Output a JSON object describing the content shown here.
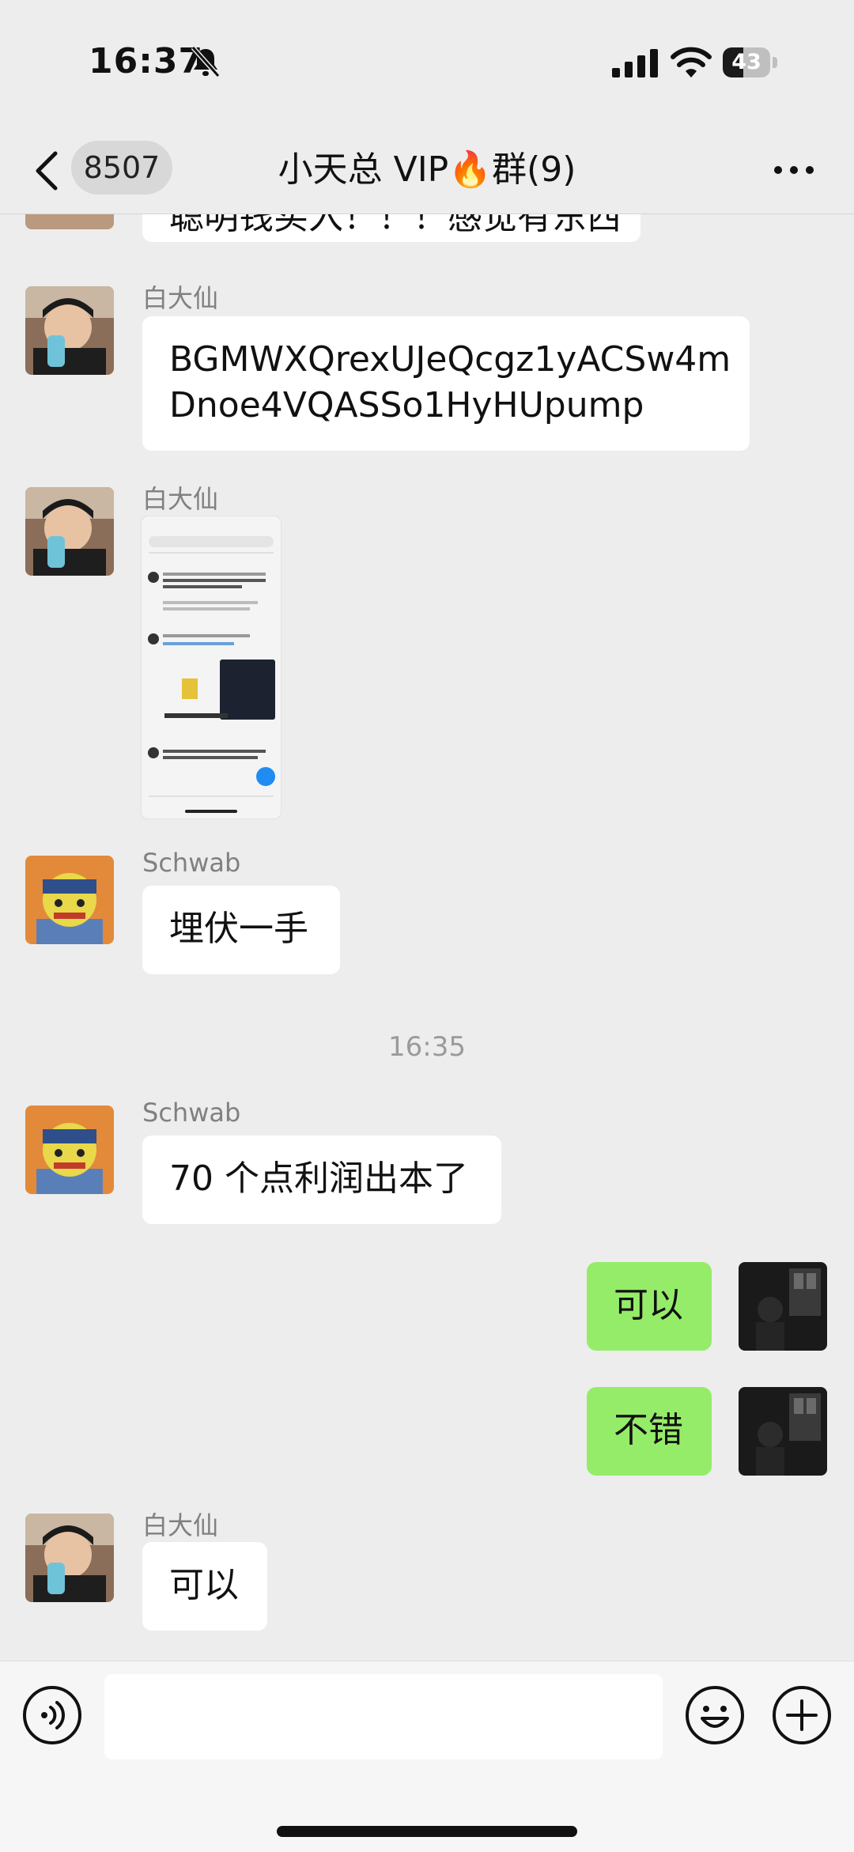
{
  "status_bar": {
    "time": "16:37",
    "battery": "43",
    "battery_level": 0.43
  },
  "nav": {
    "back_count": "8507",
    "title_prefix": "小天总 VIP",
    "title_emoji": "🔥",
    "title_suffix": "群(9)"
  },
  "messages": {
    "partial": {
      "text": "聪明钱买入！！！感觉有东西"
    },
    "m1": {
      "sender": "白大仙",
      "text_line1": "BGMWXQrexUJeQcgz1yACSw4m",
      "text_line2": "Dnoe4VQASSo1HyHUpump"
    },
    "m2": {
      "sender": "白大仙"
    },
    "m3": {
      "sender": "Schwab",
      "text": "埋伏一手"
    },
    "timestamp": "16:35",
    "m4": {
      "sender": "Schwab",
      "text": "70 个点利润出本了"
    },
    "m5": {
      "text": "可以"
    },
    "m6": {
      "text": "不错"
    },
    "m7": {
      "sender": "白大仙",
      "text": "可以"
    }
  },
  "icons": {
    "voice": "voice-icon",
    "emoji": "emoji-icon",
    "plus": "plus-icon",
    "back": "chevron-left-icon",
    "more": "more-icon"
  },
  "colors": {
    "background": "#ededed",
    "my_bubble": "#95ec69",
    "other_bubble": "#ffffff",
    "accent": "#1f8cf2"
  }
}
